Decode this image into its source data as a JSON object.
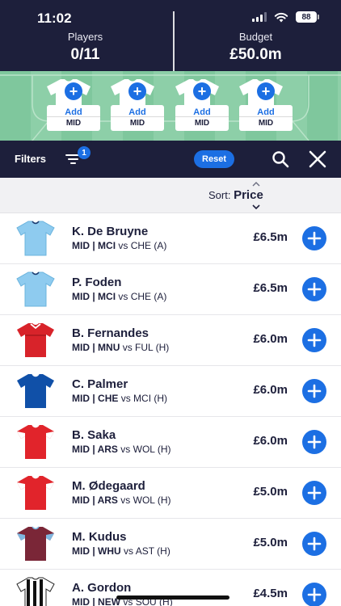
{
  "status": {
    "time": "11:02",
    "battery": "88"
  },
  "header": {
    "players_label": "Players",
    "players_value": "0/11",
    "budget_label": "Budget",
    "budget_value": "£50.0m"
  },
  "pitch_slots": [
    {
      "action": "Add",
      "position": "MID"
    },
    {
      "action": "Add",
      "position": "MID"
    },
    {
      "action": "Add",
      "position": "MID"
    },
    {
      "action": "Add",
      "position": "MID"
    }
  ],
  "filterbar": {
    "filters_label": "Filters",
    "filter_count": "1",
    "reset_label": "Reset"
  },
  "sort": {
    "label": "Sort:",
    "value": "Price"
  },
  "players": [
    {
      "name": "K. De Bruyne",
      "pos": "MID",
      "team": "MCI",
      "fixture": "vs CHE (A)",
      "price": "£6.5m",
      "kit": "light-blue"
    },
    {
      "name": "P. Foden",
      "pos": "MID",
      "team": "MCI",
      "fixture": "vs CHE (A)",
      "price": "£6.5m",
      "kit": "light-blue"
    },
    {
      "name": "B. Fernandes",
      "pos": "MID",
      "team": "MNU",
      "fixture": "vs FUL (H)",
      "price": "£6.0m",
      "kit": "red"
    },
    {
      "name": "C. Palmer",
      "pos": "MID",
      "team": "CHE",
      "fixture": "vs MCI (H)",
      "price": "£6.0m",
      "kit": "blue"
    },
    {
      "name": "B. Saka",
      "pos": "MID",
      "team": "ARS",
      "fixture": "vs WOL (H)",
      "price": "£6.0m",
      "kit": "red-white"
    },
    {
      "name": "M. Ødegaard",
      "pos": "MID",
      "team": "ARS",
      "fixture": "vs WOL (H)",
      "price": "£5.0m",
      "kit": "red-white"
    },
    {
      "name": "M. Kudus",
      "pos": "MID",
      "team": "WHU",
      "fixture": "vs AST (H)",
      "price": "£5.0m",
      "kit": "claret"
    },
    {
      "name": "A. Gordon",
      "pos": "MID",
      "team": "NEW",
      "fixture": "vs SOU (H)",
      "price": "£4.5m",
      "kit": "stripes"
    }
  ],
  "colors": {
    "navy": "#1d1f3b",
    "accent": "#1c6fe3",
    "pitch": "#7fc79d"
  },
  "icons": [
    "filter-icon",
    "search-icon",
    "close-icon",
    "plus-icon",
    "sort-arrows-icon",
    "shirt-icon"
  ]
}
